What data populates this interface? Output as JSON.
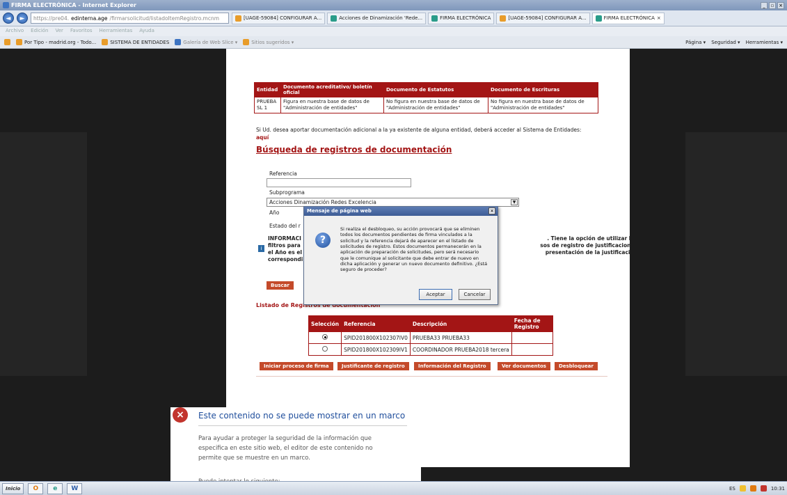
{
  "window": {
    "title": "FIRMA ELECTRÓNICA - Internet Explorer"
  },
  "address": {
    "url_prefix": "https://pre04.",
    "url_host": "edinterna.age",
    "url_path": "/firmarsolicitud/listadoItemRegistro.mcnm"
  },
  "tabs": [
    {
      "label": "[UAGE-59084] CONFIGURAR A...",
      "active": false
    },
    {
      "label": "Acciones de Dinamización 'Rede...",
      "active": false
    },
    {
      "label": "FIRMA ELECTRÓNICA",
      "active": false
    },
    {
      "label": "[UAGE-59084] CONFIGURAR A...",
      "active": false
    },
    {
      "label": "FIRMA ELECTRÓNICA",
      "active": true
    }
  ],
  "menubar": [
    "Archivo",
    "Edición",
    "Ver",
    "Favoritos",
    "Herramientas",
    "Ayuda"
  ],
  "favorites": {
    "items": [
      {
        "label": "Por Tipo - madrid.org - Todo..."
      },
      {
        "label": "SISTEMA DE ENTIDADES"
      },
      {
        "label": "Galería de Web Slice ▾"
      },
      {
        "label": "Sitios sugeridos ▾"
      }
    ],
    "right": [
      "Página ▾",
      "Seguridad ▾",
      "Herramientas ▾"
    ]
  },
  "doc_table": {
    "headers": [
      "Entidad",
      "Documento acreditativo/ boletín oficial",
      "Documento de Estatutos",
      "Documento de Escrituras"
    ],
    "rows": [
      [
        "PRUEBA SL 1",
        "Figura en nuestra base de datos de \"Administración de entidades\"",
        "No figura en nuestra base de datos de \"Administración de entidades\"",
        "No figura en nuestra base de datos de \"Administración de entidades\""
      ]
    ]
  },
  "info_text": "Si Ud. desea aportar documentación adicional a la ya existente de alguna entidad, deberá acceder al Sistema de Entidades:",
  "info_link": "aquí",
  "search": {
    "title": "Búsqueda de registros de documentación",
    "referencia_label": "Referencia",
    "referencia_value": "",
    "subprograma_label": "Subprograma",
    "subprograma_value": "Acciones Dinamización Redes Excelencia",
    "anio_label": "Año",
    "estado_label": "Estado del r",
    "buscar": "Buscar"
  },
  "info_block": {
    "left": [
      "INFORMACI",
      "filtros para",
      "el Año es el",
      "correspondi"
    ],
    "right": [
      ". Tiene la opción de utilizar los",
      "sos de registro de justificaciones",
      "presentación de la justificación",
      ""
    ]
  },
  "listado": {
    "title": "Listado de Registros de documentación",
    "headers": [
      "Selección",
      "Referencia",
      "Descripción",
      "Fecha de Registro"
    ],
    "rows": [
      {
        "selected": true,
        "referencia": "SPID201800X102307IV0",
        "descripcion": "PRUEBA33 PRUEBA33",
        "fecha": ""
      },
      {
        "selected": false,
        "referencia": "SPID201800X102309IV1",
        "descripcion": "COORDINADOR PRUEBA2018 tercera",
        "fecha": ""
      }
    ]
  },
  "actions": {
    "firma": "Iniciar proceso de firma",
    "justificante": "Justificante de registro",
    "info_registro": "Información del Registro",
    "ver_docs": "Ver documentos",
    "desbloquear": "Desbloquear"
  },
  "frame_error": {
    "title": "Este contenido no se puede mostrar en un marco",
    "text": "Para ayudar a proteger la seguridad de la información que especifica en este sitio web, el editor de este contenido no permite que se muestre en un marco.",
    "try": "Puede intentar lo siguiente:"
  },
  "dialog": {
    "title": "Mensaje de página web",
    "message": "Si realiza el desbloqueo, su acción provocará que se eliminen todos los documentos pendientes de firma vinculados a la solicitud y la referencia dejará de aparecer en el listado de solicitudes de registro. Estos documentos permanecerán en la aplicación de preparación de solicitudes, pero será necesario que le comunique al solicitante que debe entrar de nuevo en dicha aplicación y generar un nuevo documento definitivo. ¿Está seguro de proceder?",
    "ok": "Aceptar",
    "cancel": "Cancelar"
  },
  "taskbar": {
    "start": "Inicio",
    "lang": "ES",
    "time": "10:31"
  },
  "colors": {
    "brand_red": "#a31515",
    "button_red": "#c44a2a",
    "link_blue": "#1f4e9c"
  }
}
